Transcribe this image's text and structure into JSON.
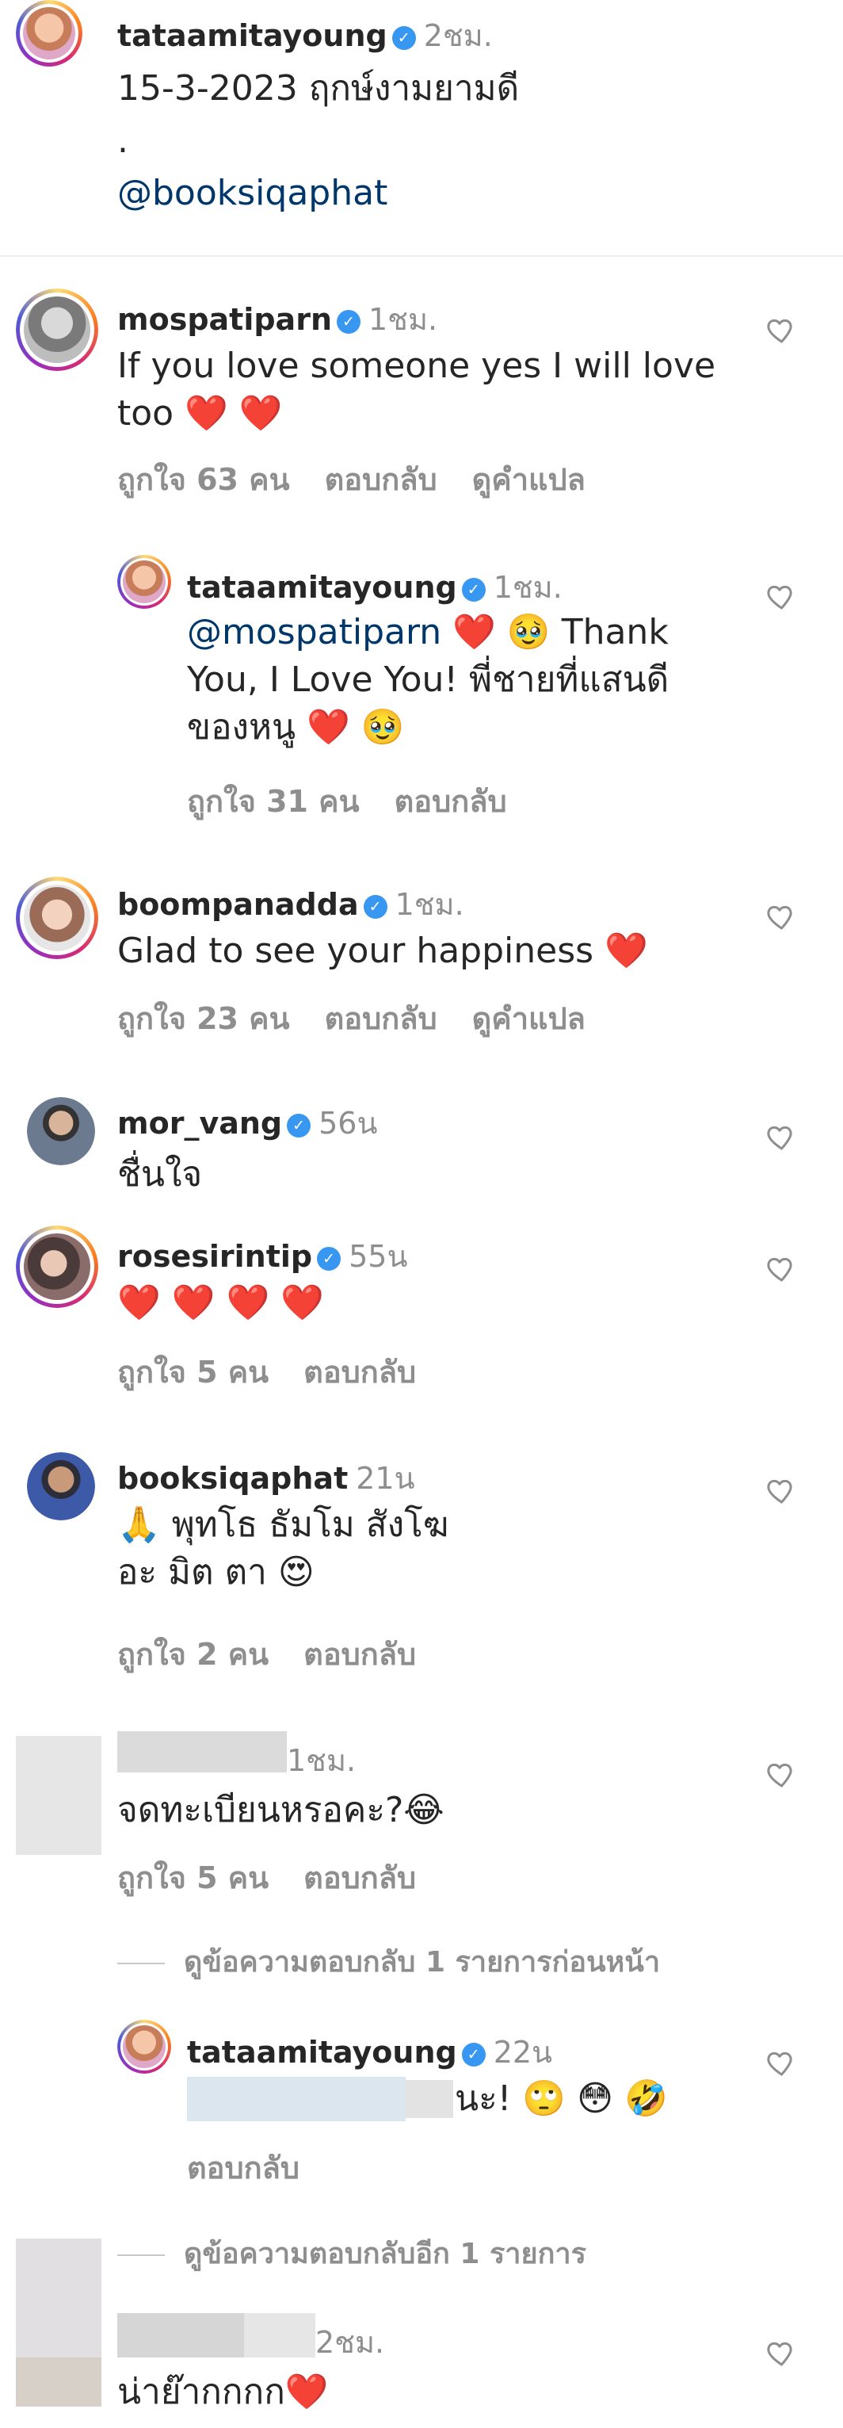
{
  "post": {
    "username": "tataamitayoung",
    "time": "2ชม.",
    "line1": "15-3-2023 ฤกษ์งามยามดี",
    "line2": ".",
    "mention": "@booksiqaphat"
  },
  "comments": [
    {
      "username": "mospatiparn",
      "time": "1ชม.",
      "text": "If you love someone yes I will love too ❤️ ❤️",
      "likes": "ถูกใจ 63 คน",
      "reply": "ตอบกลับ",
      "translate": "ดูคำแปล"
    },
    {
      "username": "tataamitayoung",
      "time": "1ชม.",
      "mention": "@mospatiparn",
      "text1": " ❤️ 🥹 Thank",
      "text2": "You, I Love You! พี่ชายที่แสนดี",
      "text3": "ของหนู ❤️ 🥹",
      "likes": "ถูกใจ 31 คน",
      "reply": "ตอบกลับ"
    },
    {
      "username": "boompanadda",
      "time": "1ชม.",
      "text": "Glad to see your happiness ❤️",
      "likes": "ถูกใจ 23 คน",
      "reply": "ตอบกลับ",
      "translate": "ดูคำแปล"
    },
    {
      "username": "mor_vang",
      "time": "56น",
      "text": "ชื่นใจ"
    },
    {
      "username": "rosesirintip",
      "time": "55น",
      "text": "❤️ ❤️ ❤️ ❤️",
      "likes": "ถูกใจ 5 คน",
      "reply": "ตอบกลับ"
    },
    {
      "username": "booksiqaphat",
      "time": "21น",
      "text1": "🙏 พุทโธ ธัมโม สังโฆ",
      "text2": "อะ มิต ตา 😍",
      "likes": "ถูกใจ 2 คน",
      "reply": "ตอบกลับ"
    },
    {
      "time": "1ชม.",
      "text": "จดทะเบียนหรอคะ?😂",
      "likes": "ถูกใจ 5 คน",
      "reply": "ตอบกลับ"
    },
    {
      "username": "tataamitayoung",
      "time": "22น",
      "text": "นะ! 🙄 😳 🤣",
      "reply": "ตอบกลับ"
    },
    {
      "time": "2ชม.",
      "text": "น่าย๊ากกกก❤️"
    }
  ],
  "view_replies_prev": "ดูข้อความตอบกลับ 1 รายการก่อนหน้า",
  "view_replies_more": "ดูข้อความตอบกลับอีก 1 รายการ",
  "verified_mark": "✓",
  "colors": {
    "verified": "#3897f0",
    "mention": "#00376b",
    "muted": "#8e8e8e"
  }
}
